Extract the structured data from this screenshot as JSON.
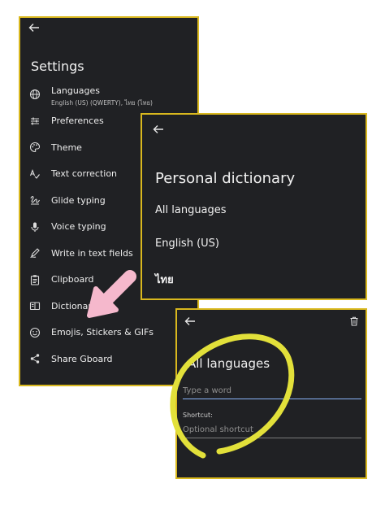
{
  "settings": {
    "title": "Settings",
    "items": [
      {
        "label": "Languages",
        "sublabel": "English (US) (QWERTY), ไทย (ไทย)",
        "icon": "globe-icon"
      },
      {
        "label": "Preferences",
        "icon": "sliders-icon"
      },
      {
        "label": "Theme",
        "icon": "palette-icon"
      },
      {
        "label": "Text correction",
        "icon": "spellcheck-icon"
      },
      {
        "label": "Glide typing",
        "icon": "gesture-icon"
      },
      {
        "label": "Voice typing",
        "icon": "microphone-icon"
      },
      {
        "label": "Write in text fields",
        "icon": "pen-icon"
      },
      {
        "label": "Clipboard",
        "icon": "clipboard-icon"
      },
      {
        "label": "Dictionary",
        "icon": "book-icon"
      },
      {
        "label": "Emojis, Stickers & GIFs",
        "icon": "smiley-icon"
      },
      {
        "label": "Share Gboard",
        "icon": "share-icon"
      }
    ]
  },
  "dictionary": {
    "title": "Personal dictionary",
    "items": [
      "All languages",
      "English (US)",
      "ไทย"
    ]
  },
  "word_editor": {
    "title": "All languages",
    "word_placeholder": "Type a word",
    "shortcut_label": "Shortcut:",
    "shortcut_placeholder": "Optional shortcut"
  },
  "colors": {
    "panel_bg": "#202124",
    "panel_border": "#d9b81e",
    "arrow_annotation": "#f5b8cc",
    "circle_annotation": "#e2e03a",
    "focus_underline": "#8ab4f8"
  }
}
